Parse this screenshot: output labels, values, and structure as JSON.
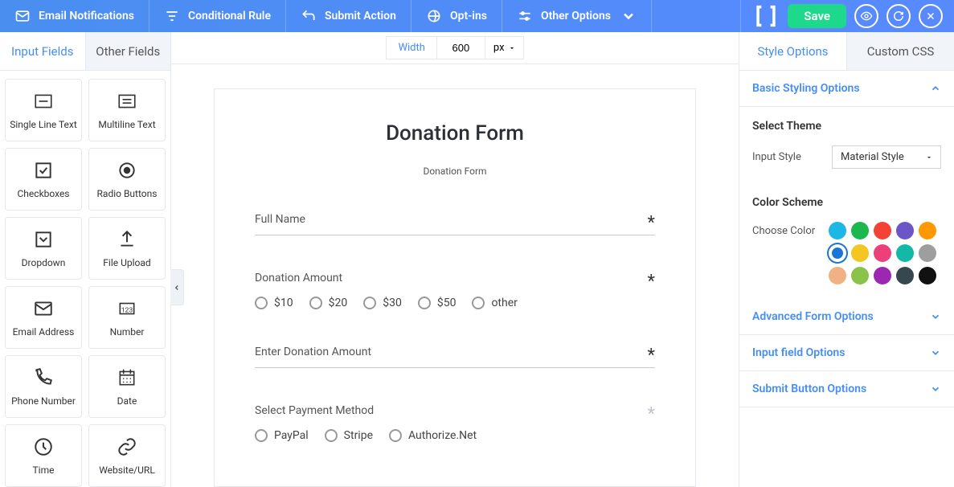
{
  "topbar": {
    "items": [
      {
        "label": "Email Notifications"
      },
      {
        "label": "Conditional Rule"
      },
      {
        "label": "Submit Action"
      },
      {
        "label": "Opt-ins"
      },
      {
        "label": "Other Options"
      }
    ],
    "save": "Save"
  },
  "left": {
    "tabs": {
      "input": "Input Fields",
      "other": "Other Fields"
    },
    "fields": [
      {
        "label": "Single Line Text"
      },
      {
        "label": "Multiline Text"
      },
      {
        "label": "Checkboxes"
      },
      {
        "label": "Radio Buttons"
      },
      {
        "label": "Dropdown"
      },
      {
        "label": "File Upload"
      },
      {
        "label": "Email Address"
      },
      {
        "label": "Number"
      },
      {
        "label": "Phone Number"
      },
      {
        "label": "Date"
      },
      {
        "label": "Time"
      },
      {
        "label": "Website/URL"
      }
    ]
  },
  "canvas": {
    "width_label": "Width",
    "width_value": "600",
    "width_unit": "px",
    "form": {
      "title": "Donation Form",
      "subtitle": "Donation Form",
      "fields": {
        "full_name": {
          "label": "Full Name"
        },
        "donation_amount": {
          "label": "Donation Amount",
          "options": [
            "$10",
            "$20",
            "$30",
            "$50",
            "other"
          ]
        },
        "enter_amount": {
          "label": "Enter Donation Amount"
        },
        "payment": {
          "label": "Select Payment Method",
          "options": [
            "PayPal",
            "Stripe",
            "Authorize.Net"
          ]
        }
      }
    }
  },
  "right": {
    "tabs": {
      "style": "Style Options",
      "custom": "Custom CSS"
    },
    "sections": {
      "basic": "Basic Styling Options",
      "theme": "Select Theme",
      "input_style_label": "Input Style",
      "input_style_value": "Material Style",
      "color_scheme": "Color Scheme",
      "choose_color": "Choose Color",
      "advanced": "Advanced Form Options",
      "input_field": "Input field Options",
      "submit": "Submit Button Options"
    },
    "colors": [
      "#1cb7e5",
      "#1cb84e",
      "#f44336",
      "#6a56c7",
      "#ff9800",
      "#1976d2",
      "#f4c623",
      "#ec407a",
      "#14b8a6",
      "#9e9e9e",
      "#f0b285",
      "#8bc34a",
      "#9c27b0",
      "#37474f",
      "#111111"
    ],
    "selected_color_index": 5
  }
}
